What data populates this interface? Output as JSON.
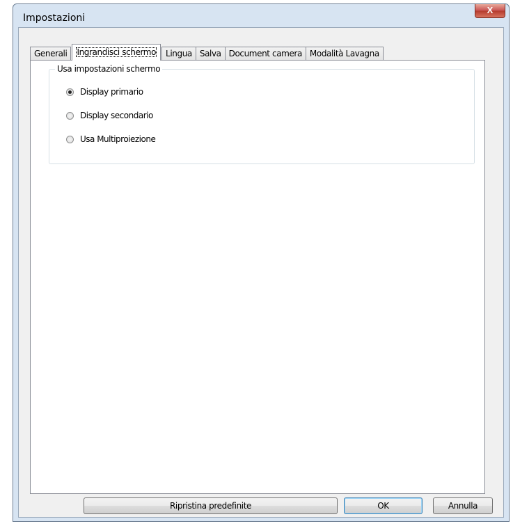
{
  "window": {
    "title": "Impostazioni",
    "close_glyph": "X"
  },
  "tabs": [
    {
      "label": "Generali",
      "active": false
    },
    {
      "label": "Ingrandisci schermo",
      "active": true
    },
    {
      "label": "Lingua",
      "active": false
    },
    {
      "label": "Salva",
      "active": false
    },
    {
      "label": "Document camera",
      "active": false
    },
    {
      "label": "Modalità Lavagna",
      "active": false
    }
  ],
  "group": {
    "title": "Usa impostazioni schermo",
    "options": [
      {
        "label": "Display primario",
        "checked": true
      },
      {
        "label": "Display secondario",
        "checked": false
      },
      {
        "label": "Usa Multiproiezione",
        "checked": false
      }
    ]
  },
  "buttons": {
    "reset": "Ripristina predefinite",
    "ok": "OK",
    "cancel": "Annulla"
  }
}
